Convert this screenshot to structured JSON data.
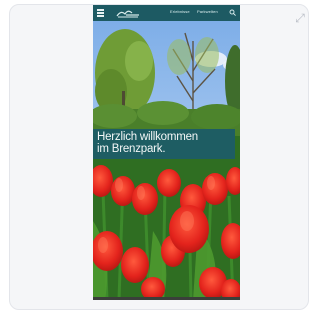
{
  "nav": {
    "logo_name": "logo-mark",
    "link_1": "Erlebnisse",
    "link_2": "Parkwelten",
    "menu_icon": "menu-icon",
    "search_icon": "search-icon"
  },
  "hero": {
    "headline_line_1": "Herzlich willkommen",
    "headline_line_2": "im Brenzpark."
  },
  "colors": {
    "nav_bg": "#1d5a63",
    "banner_bg": "#1e5d63",
    "tulip_red": "#e3231c",
    "sky_blue": "#8fb8ea"
  }
}
